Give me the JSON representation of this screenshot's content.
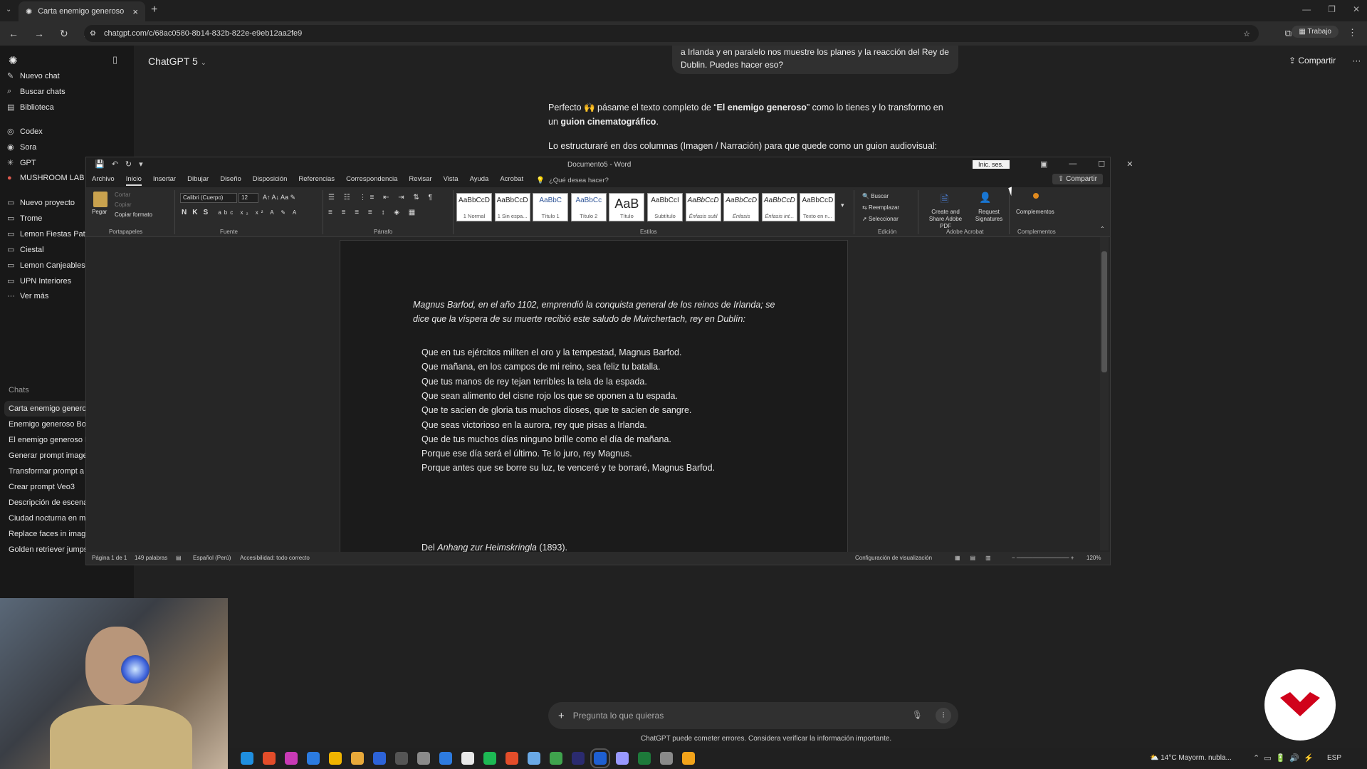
{
  "browser": {
    "tab_title": "Carta enemigo generoso",
    "url": "chatgpt.com/c/68ac0580-8b14-832b-822e-e9eb12aa2fe9",
    "profile_label": "Trabajo"
  },
  "chatgpt": {
    "model_label": "ChatGPT 5",
    "share_label": "Compartir",
    "sidebar": {
      "top_items": [
        {
          "label": "Nuevo chat",
          "icon": "edit-icon"
        },
        {
          "label": "Buscar chats",
          "icon": "search-icon"
        },
        {
          "label": "Biblioteca",
          "icon": "library-icon"
        },
        {
          "label": "Codex",
          "icon": "codex-icon"
        },
        {
          "label": "Sora",
          "icon": "sora-icon"
        },
        {
          "label": "GPT",
          "icon": "gpt-icon"
        },
        {
          "label": "MUSHROOM LAB V",
          "icon": "mushroom-icon"
        },
        {
          "label": "Nuevo proyecto",
          "icon": "folder-plus-icon"
        },
        {
          "label": "Trome",
          "icon": "folder-icon"
        },
        {
          "label": "Lemon Fiestas Patri",
          "icon": "folder-icon"
        },
        {
          "label": "Ciestal",
          "icon": "folder-icon"
        },
        {
          "label": "Lemon Canjeables",
          "icon": "folder-icon"
        },
        {
          "label": "UPN Interiores",
          "icon": "folder-icon"
        },
        {
          "label": "Ver más",
          "icon": "more-icon"
        }
      ],
      "chats_heading": "Chats",
      "chats": [
        "Carta enemigo generoso",
        "Enemigo generoso Borg",
        "El enemigo generoso B",
        "Generar prompt imagen",
        "Transformar prompt a J",
        "Crear prompt Veo3",
        "Descripción de escena",
        "Ciudad nocturna en mo",
        "Replace faces in image",
        "Golden retriever jumps scene"
      ]
    },
    "user_message_lines": [
      "a Irlanda y en paralelo nos muestre los planes y la reacción del Rey de",
      "Dublin. Puedes hacer eso?"
    ],
    "assistant_p1_pre": "Perfecto 🙌 pásame el texto completo de “",
    "assistant_p1_bold": "El enemigo generoso",
    "assistant_p1_mid": "” como lo tienes y lo transformo en un",
    "assistant_p1_bold2": "guion cinematográfico",
    "assistant_p1_end": ".",
    "assistant_p2": "Lo estructuraré en dos columnas (Imagen / Narración) para que quede como un guion audiovisual:",
    "composer_placeholder": "Pregunta lo que quieras",
    "disclaimer": "ChatGPT puede cometer errores. Considera verificar la información importante."
  },
  "word": {
    "title": "Documento5 - Word",
    "signin_label": "Inic. ses.",
    "share_label": "Compartir",
    "tabs": [
      "Archivo",
      "Inicio",
      "Insertar",
      "Dibujar",
      "Diseño",
      "Disposición",
      "Referencias",
      "Correspondencia",
      "Revisar",
      "Vista",
      "Ayuda",
      "Acrobat"
    ],
    "tell_me": "¿Qué desea hacer?",
    "ribbon": {
      "paste": "Pegar",
      "cut": "Cortar",
      "copy": "Copiar",
      "format_painter": "Copiar formato",
      "font_name": "Calibri (Cuerpo)",
      "font_size": "12",
      "groups": [
        "Portapapeles",
        "Fuente",
        "Párrafo",
        "Estilos",
        "Edición",
        "Adobe Acrobat",
        "Complementos"
      ],
      "styles": [
        {
          "sample": "AaBbCcD",
          "name": "1 Normal"
        },
        {
          "sample": "AaBbCcD",
          "name": "1 Sin espa..."
        },
        {
          "sample": "AaBbC",
          "name": "Título 1"
        },
        {
          "sample": "AaBbCc",
          "name": "Título 2"
        },
        {
          "sample": "AaB",
          "name": "Título"
        },
        {
          "sample": "AaBbCcI",
          "name": "Subtítulo"
        },
        {
          "sample": "AaBbCcD",
          "name": "Énfasis sutil"
        },
        {
          "sample": "AaBbCcD",
          "name": "Énfasis"
        },
        {
          "sample": "AaBbCcD",
          "name": "Énfasis int..."
        },
        {
          "sample": "AaBbCcD",
          "name": "Texto en n..."
        }
      ],
      "find": "Buscar",
      "replace": "Reemplazar",
      "select": "Seleccionar",
      "create_share_pdf": "Create and Share Adobe PDF",
      "request_signatures": "Request Signatures",
      "addins": "Complementos"
    },
    "document": {
      "intro": "Magnus Barfod, en el año 1102, emprendió la conquista general de los reinos de Irlanda; se dice que la víspera de su muerte recibió este saludo de Muirchertach, rey en Dublín:",
      "poem": [
        "Que en tus ejércitos militen el oro y la tempestad, Magnus Barfod.",
        "Que mañana, en los campos de mi reino, sea feliz tu batalla.",
        "Que tus manos de rey tejan terribles la tela de la espada.",
        "Que sean alimento del cisne rojo los que se oponen a tu espada.",
        "Que te sacien de gloria tus muchos dioses, que te sacien de sangre.",
        "Que seas victorioso en la aurora, rey que pisas a Irlanda.",
        "Que de tus muchos días ninguno brille como el día de mañana.",
        "Porque ese día será el último. Te lo juro, rey Magnus.",
        "Porque antes que se borre su luz, te venceré y te borraré, Magnus Barfod."
      ],
      "source_pre": "Del ",
      "source_italic": "Anhang zur Heimskringla",
      "source_post": " (1893)."
    },
    "status": {
      "page": "Página 1 de 1",
      "words": "149 palabras",
      "language": "Español (Perú)",
      "accessibility": "Accesibilidad: todo correcto",
      "display_settings": "Configuración de visualización",
      "zoom": "120%"
    }
  },
  "taskbar": {
    "weather": "14°C  Mayorm. nubla...",
    "language": "ESP"
  },
  "colors": {
    "logo_red": "#d0021b"
  }
}
